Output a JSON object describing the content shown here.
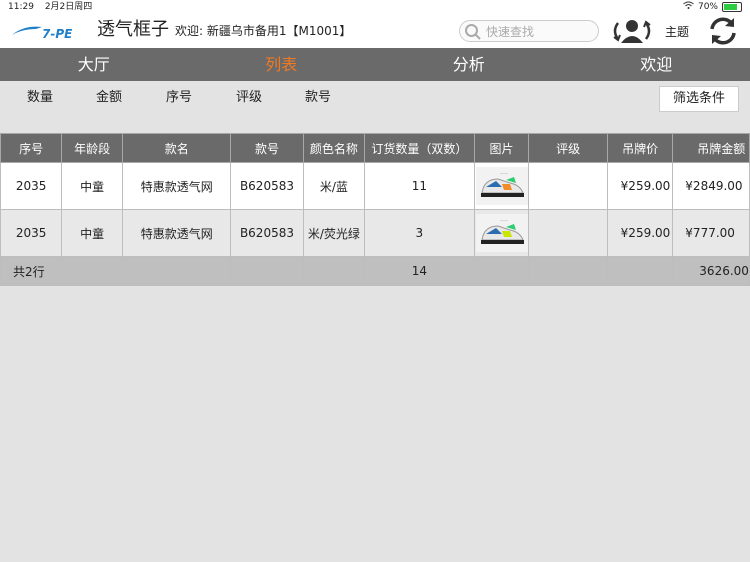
{
  "status": {
    "time": "11:29",
    "date": "2月2日周四",
    "battery": "70%",
    "battery_level": 0.7
  },
  "header": {
    "logo": "7-PE",
    "title": "透气框子",
    "welcome": "欢迎: 新疆乌市备用1【M1001】",
    "search_placeholder": "快速查找",
    "theme_label": "主题"
  },
  "nav": {
    "tabs": [
      "大厅",
      "列表",
      "分析",
      "欢迎"
    ],
    "active_index": 1
  },
  "sort": {
    "options": [
      "数量",
      "金额",
      "序号",
      "评级",
      "款号"
    ],
    "filter_label": "筛选条件"
  },
  "table": {
    "headers": [
      "序号",
      "年龄段",
      "款名",
      "款号",
      "颜色名称",
      "订货数量（双数）",
      "图片",
      "评级",
      "吊牌价",
      "吊牌金额"
    ],
    "rows": [
      {
        "seq": "2035",
        "age": "中童",
        "name": "特惠款透气网",
        "code": "B620583",
        "color": "米/蓝",
        "qty": "11",
        "image": "shoe-thumbnail",
        "rating": "",
        "price": "¥259.00",
        "amount": "¥2849.00"
      },
      {
        "seq": "2035",
        "age": "中童",
        "name": "特惠款透气网",
        "code": "B620583",
        "color": "米/荧光绿",
        "qty": "3",
        "image": "shoe-thumbnail",
        "rating": "",
        "price": "¥259.00",
        "amount": "¥777.00"
      }
    ],
    "total": {
      "label": "共2行",
      "qty": "14",
      "amount": "3626.00"
    }
  },
  "colors": {
    "nav_bg": "#6a6a6a",
    "accent": "#f07a22",
    "logo_blue": "#1f7fc8"
  }
}
